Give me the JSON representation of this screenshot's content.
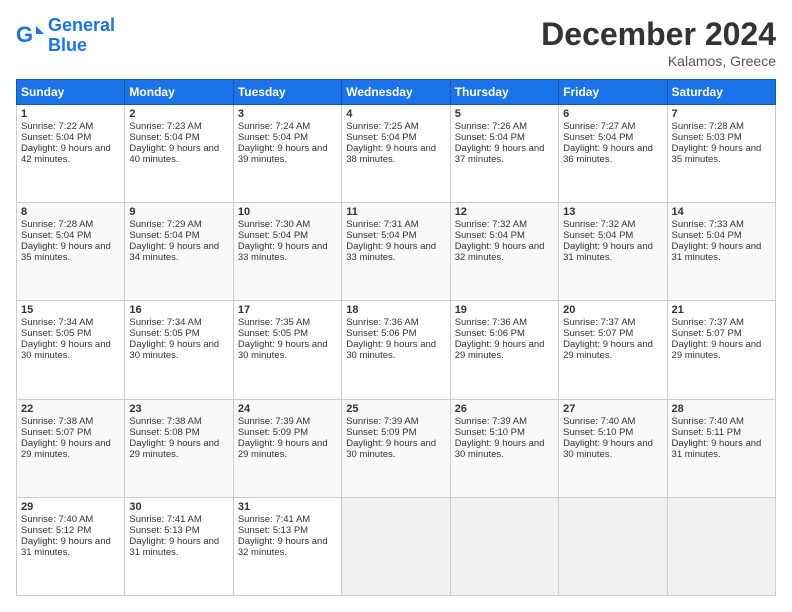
{
  "header": {
    "logo_line1": "General",
    "logo_line2": "Blue",
    "month_year": "December 2024",
    "location": "Kalamos, Greece"
  },
  "weekdays": [
    "Sunday",
    "Monday",
    "Tuesday",
    "Wednesday",
    "Thursday",
    "Friday",
    "Saturday"
  ],
  "weeks": [
    [
      {
        "day": "1",
        "sunrise": "7:22 AM",
        "sunset": "5:04 PM",
        "daylight": "9 hours and 42 minutes."
      },
      {
        "day": "2",
        "sunrise": "7:23 AM",
        "sunset": "5:04 PM",
        "daylight": "9 hours and 40 minutes."
      },
      {
        "day": "3",
        "sunrise": "7:24 AM",
        "sunset": "5:04 PM",
        "daylight": "9 hours and 39 minutes."
      },
      {
        "day": "4",
        "sunrise": "7:25 AM",
        "sunset": "5:04 PM",
        "daylight": "9 hours and 38 minutes."
      },
      {
        "day": "5",
        "sunrise": "7:26 AM",
        "sunset": "5:04 PM",
        "daylight": "9 hours and 37 minutes."
      },
      {
        "day": "6",
        "sunrise": "7:27 AM",
        "sunset": "5:04 PM",
        "daylight": "9 hours and 36 minutes."
      },
      {
        "day": "7",
        "sunrise": "7:28 AM",
        "sunset": "5:03 PM",
        "daylight": "9 hours and 35 minutes."
      }
    ],
    [
      {
        "day": "8",
        "sunrise": "7:28 AM",
        "sunset": "5:04 PM",
        "daylight": "9 hours and 35 minutes."
      },
      {
        "day": "9",
        "sunrise": "7:29 AM",
        "sunset": "5:04 PM",
        "daylight": "9 hours and 34 minutes."
      },
      {
        "day": "10",
        "sunrise": "7:30 AM",
        "sunset": "5:04 PM",
        "daylight": "9 hours and 33 minutes."
      },
      {
        "day": "11",
        "sunrise": "7:31 AM",
        "sunset": "5:04 PM",
        "daylight": "9 hours and 33 minutes."
      },
      {
        "day": "12",
        "sunrise": "7:32 AM",
        "sunset": "5:04 PM",
        "daylight": "9 hours and 32 minutes."
      },
      {
        "day": "13",
        "sunrise": "7:32 AM",
        "sunset": "5:04 PM",
        "daylight": "9 hours and 31 minutes."
      },
      {
        "day": "14",
        "sunrise": "7:33 AM",
        "sunset": "5:04 PM",
        "daylight": "9 hours and 31 minutes."
      }
    ],
    [
      {
        "day": "15",
        "sunrise": "7:34 AM",
        "sunset": "5:05 PM",
        "daylight": "9 hours and 30 minutes."
      },
      {
        "day": "16",
        "sunrise": "7:34 AM",
        "sunset": "5:05 PM",
        "daylight": "9 hours and 30 minutes."
      },
      {
        "day": "17",
        "sunrise": "7:35 AM",
        "sunset": "5:05 PM",
        "daylight": "9 hours and 30 minutes."
      },
      {
        "day": "18",
        "sunrise": "7:36 AM",
        "sunset": "5:06 PM",
        "daylight": "9 hours and 30 minutes."
      },
      {
        "day": "19",
        "sunrise": "7:36 AM",
        "sunset": "5:06 PM",
        "daylight": "9 hours and 29 minutes."
      },
      {
        "day": "20",
        "sunrise": "7:37 AM",
        "sunset": "5:07 PM",
        "daylight": "9 hours and 29 minutes."
      },
      {
        "day": "21",
        "sunrise": "7:37 AM",
        "sunset": "5:07 PM",
        "daylight": "9 hours and 29 minutes."
      }
    ],
    [
      {
        "day": "22",
        "sunrise": "7:38 AM",
        "sunset": "5:07 PM",
        "daylight": "9 hours and 29 minutes."
      },
      {
        "day": "23",
        "sunrise": "7:38 AM",
        "sunset": "5:08 PM",
        "daylight": "9 hours and 29 minutes."
      },
      {
        "day": "24",
        "sunrise": "7:39 AM",
        "sunset": "5:09 PM",
        "daylight": "9 hours and 29 minutes."
      },
      {
        "day": "25",
        "sunrise": "7:39 AM",
        "sunset": "5:09 PM",
        "daylight": "9 hours and 30 minutes."
      },
      {
        "day": "26",
        "sunrise": "7:39 AM",
        "sunset": "5:10 PM",
        "daylight": "9 hours and 30 minutes."
      },
      {
        "day": "27",
        "sunrise": "7:40 AM",
        "sunset": "5:10 PM",
        "daylight": "9 hours and 30 minutes."
      },
      {
        "day": "28",
        "sunrise": "7:40 AM",
        "sunset": "5:11 PM",
        "daylight": "9 hours and 31 minutes."
      }
    ],
    [
      {
        "day": "29",
        "sunrise": "7:40 AM",
        "sunset": "5:12 PM",
        "daylight": "9 hours and 31 minutes."
      },
      {
        "day": "30",
        "sunrise": "7:41 AM",
        "sunset": "5:13 PM",
        "daylight": "9 hours and 31 minutes."
      },
      {
        "day": "31",
        "sunrise": "7:41 AM",
        "sunset": "5:13 PM",
        "daylight": "9 hours and 32 minutes."
      },
      null,
      null,
      null,
      null
    ]
  ]
}
